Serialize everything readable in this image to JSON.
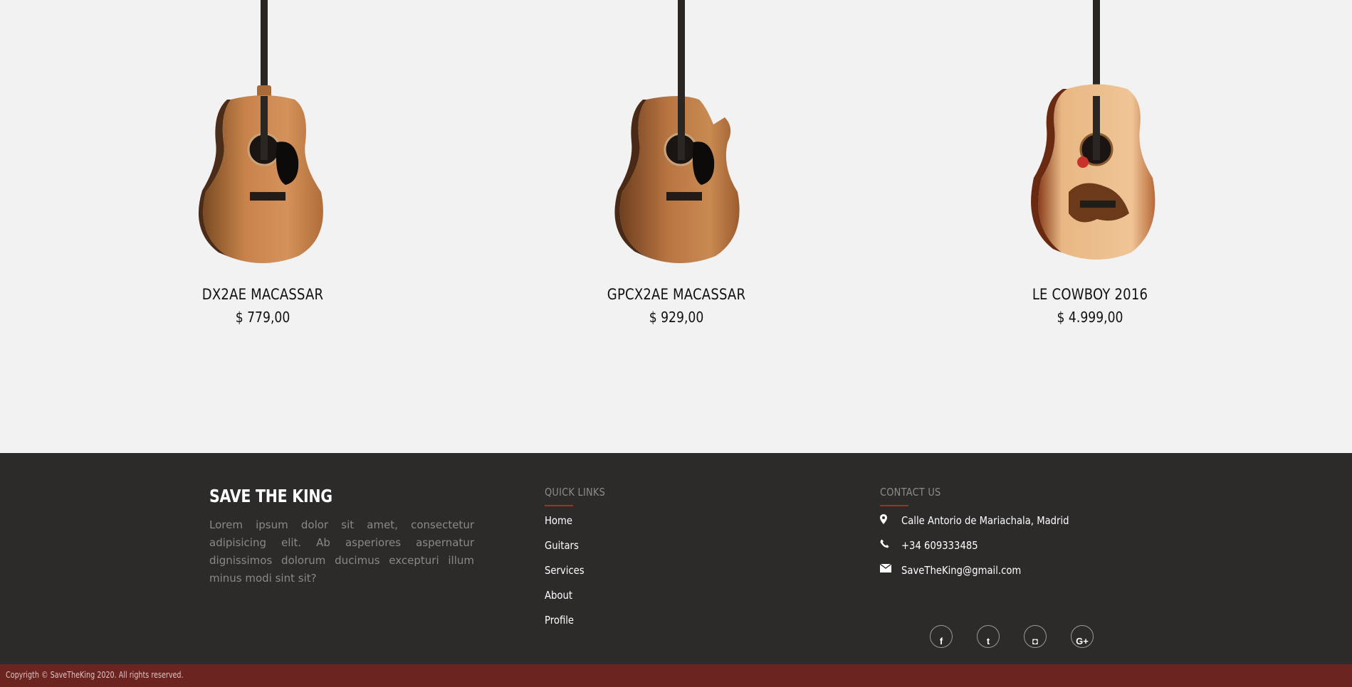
{
  "products": [
    {
      "name": "DX2AE MACASSAR",
      "price": "$ 779,00",
      "icon": "guitar-dreadnought-image"
    },
    {
      "name": "GPCX2AE MACASSAR",
      "price": "$ 929,00",
      "icon": "guitar-cutaway-image"
    },
    {
      "name": "LE COWBOY 2016",
      "price": "$ 4.999,00",
      "icon": "guitar-cowboy-image"
    }
  ],
  "footer": {
    "brand": {
      "title": "SAVE THE KING",
      "description": "Lorem ipsum dolor sit amet, consectetur adipisicing elit. Ab asperiores aspernatur dignissimos dolorum ducimus excepturi illum minus modi sint sit?"
    },
    "quick_links": {
      "heading": "QUICK LINKS",
      "items": [
        "Home",
        "Guitars",
        "Services",
        "About",
        "Profile"
      ]
    },
    "contact": {
      "heading": "CONTACT US",
      "address": "Calle Antorio de Mariachala, Madrid",
      "phone": "+34 609333485",
      "email": "SaveTheKing@gmail.com",
      "icons": [
        "map-marker-icon",
        "phone-icon",
        "envelope-icon"
      ]
    },
    "socials": [
      {
        "icon": "facebook-icon",
        "glyph": "f"
      },
      {
        "icon": "twitter-icon",
        "glyph": "t"
      },
      {
        "icon": "instagram-icon",
        "glyph": "◘"
      },
      {
        "icon": "google-plus-icon",
        "glyph": "G+"
      }
    ]
  },
  "bottom_bar": {
    "copyright": "Copyrigth © SaveTheKing 2020. All rights reserved."
  },
  "colors": {
    "page_bg": "#f2f2f2",
    "footer_bg": "#2d2a2a",
    "accent": "#b02a22",
    "bottom_bar_bg": "#6b2420"
  }
}
